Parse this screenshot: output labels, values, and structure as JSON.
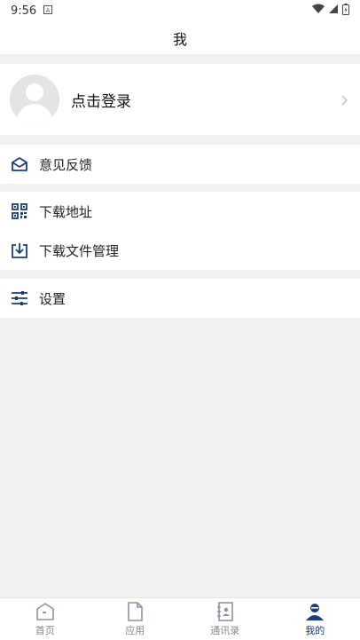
{
  "status_bar": {
    "time": "9:56"
  },
  "header": {
    "title": "我"
  },
  "profile": {
    "login_label": "点击登录"
  },
  "menu": {
    "feedback": "意见反馈",
    "download_address": "下载地址",
    "download_manager": "下载文件管理",
    "settings": "设置"
  },
  "tabs": [
    {
      "label": "首页",
      "icon": "home-icon"
    },
    {
      "label": "应用",
      "icon": "document-icon"
    },
    {
      "label": "通讯录",
      "icon": "contacts-icon"
    },
    {
      "label": "我的",
      "icon": "person-icon",
      "active": true
    }
  ],
  "colors": {
    "accent": "#1a3d7c",
    "background": "#f1f1f1"
  }
}
